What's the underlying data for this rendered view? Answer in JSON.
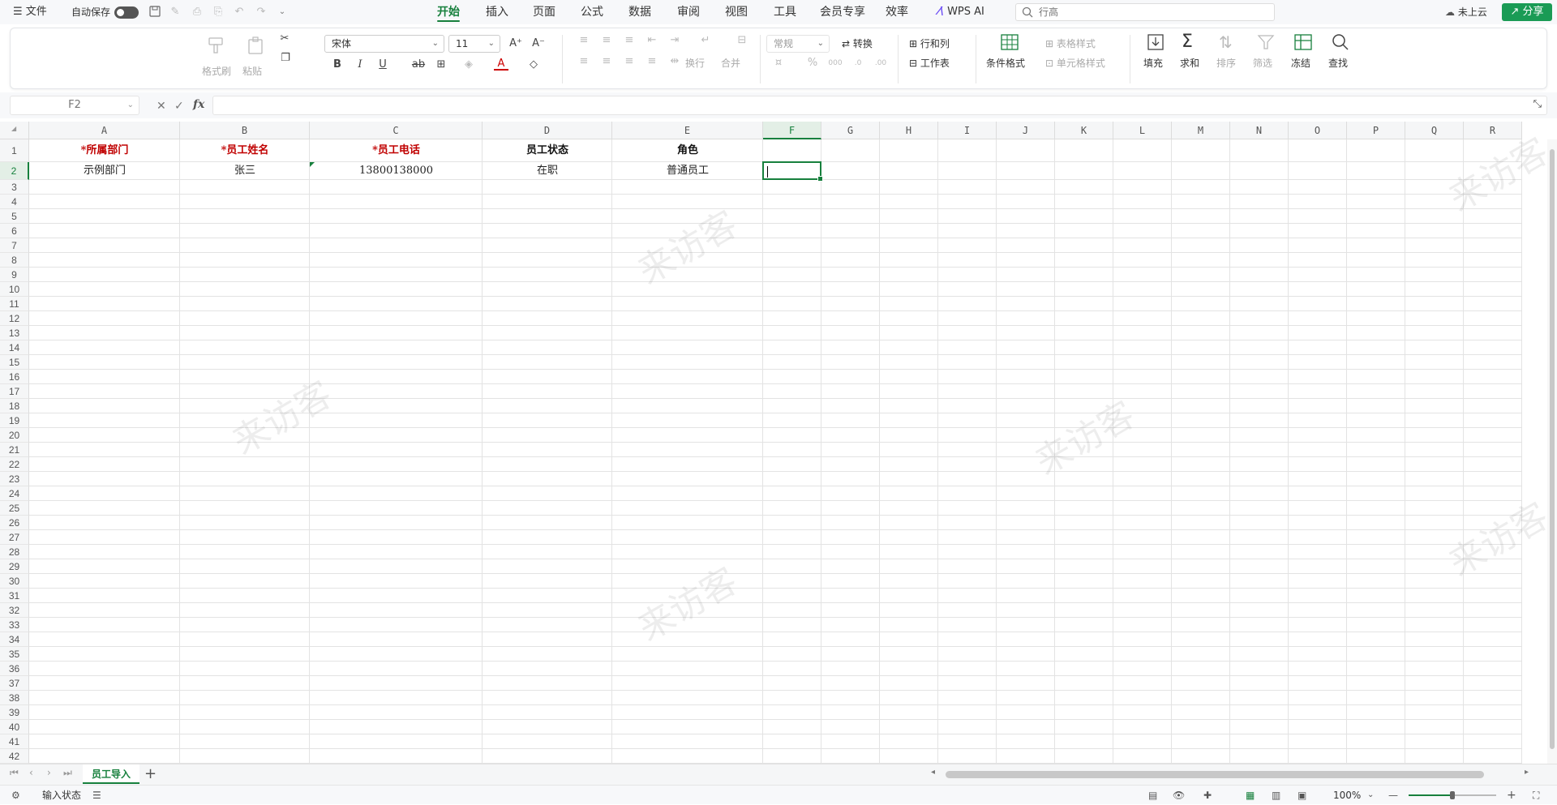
{
  "topbar": {
    "menu_label": "文件",
    "autosave_label": "自动保存",
    "tabs": [
      {
        "label": "开始"
      },
      {
        "label": "插入"
      },
      {
        "label": "页面"
      },
      {
        "label": "公式"
      },
      {
        "label": "数据"
      },
      {
        "label": "审阅"
      },
      {
        "label": "视图"
      },
      {
        "label": "工具"
      },
      {
        "label": "会员专享"
      },
      {
        "label": "效率"
      }
    ],
    "ai_label": "WPS AI",
    "search_placeholder": "行高",
    "cloud_label": "未上云",
    "share_label": "分享"
  },
  "ribbon": {
    "format_painter": "格式刷",
    "paste": "粘贴",
    "font_name": "宋体",
    "font_size": "11",
    "wrap": "换行",
    "merge": "合并",
    "number_format": "常规",
    "convert": "转换",
    "row_col": "行和列",
    "worksheet": "工作表",
    "cond_format": "条件格式",
    "table_style": "表格样式",
    "cell_style": "单元格样式",
    "fill": "填充",
    "sum": "求和",
    "sort": "排序",
    "filter": "筛选",
    "freeze": "冻结",
    "find": "查找"
  },
  "formula_bar": {
    "name_box": "F2",
    "fx": "fx",
    "content": ""
  },
  "sheet": {
    "columns": [
      "A",
      "B",
      "C",
      "D",
      "E",
      "F",
      "G",
      "H",
      "I",
      "J",
      "K",
      "L",
      "M",
      "N",
      "O",
      "P",
      "Q",
      "R"
    ],
    "active_column": "F",
    "active_row": 2,
    "rows": [
      "1",
      "2",
      "3",
      "4",
      "5",
      "6",
      "7",
      "8",
      "9",
      "10",
      "11",
      "12",
      "13",
      "14",
      "15",
      "16",
      "17",
      "18",
      "19",
      "20",
      "21",
      "22",
      "23",
      "24",
      "25",
      "26",
      "27",
      "28",
      "29",
      "30",
      "31",
      "32",
      "33",
      "34",
      "35",
      "36",
      "37",
      "38",
      "39",
      "40",
      "41",
      "42"
    ],
    "header_row": [
      {
        "text": "*所属部门",
        "required": true
      },
      {
        "text": "*员工姓名",
        "required": true
      },
      {
        "text": "*员工电话",
        "required": true
      },
      {
        "text": "员工状态",
        "required": false
      },
      {
        "text": "角色",
        "required": false
      }
    ],
    "data_row": [
      "示例部门",
      "张三",
      "13800138000",
      "在职",
      "普通员工"
    ],
    "watermark_text": "来访客"
  },
  "sheet_tabs": [
    {
      "label": "员工导入"
    }
  ],
  "statusbar": {
    "mode": "输入状态",
    "zoom": "100%",
    "zoom_fraction": 0.5
  },
  "colors": {
    "accent": "#17803d",
    "required": "#c00000",
    "share_button": "#1a9b55"
  }
}
